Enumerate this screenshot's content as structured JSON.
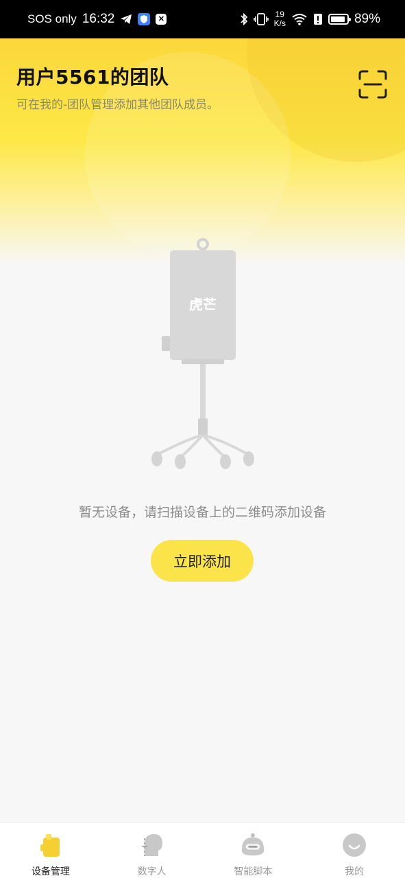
{
  "status_bar": {
    "carrier": "SOS only",
    "time": "16:32",
    "speed_value": "19",
    "speed_unit": "K/s",
    "battery": "89%",
    "battery_level": 0.89
  },
  "header": {
    "title": "用户5561的团队",
    "subtitle": "可在我的-团队管理添加其他团队成员。"
  },
  "illustration": {
    "brand": "虎芒"
  },
  "empty_state": {
    "message": "暂无设备，请扫描设备上的二维码添加设备",
    "button_label": "立即添加"
  },
  "nav": {
    "items": [
      {
        "label": "设备管理",
        "icon": "device-icon",
        "active": true
      },
      {
        "label": "数字人",
        "icon": "digital-human-icon",
        "active": false
      },
      {
        "label": "智能脚本",
        "icon": "robot-icon",
        "active": false
      },
      {
        "label": "我的",
        "icon": "profile-icon",
        "active": false
      }
    ]
  },
  "colors": {
    "accent": "#fbe34a",
    "header_gradient_top": "#fbd73b",
    "background": "#f7f7f7"
  }
}
